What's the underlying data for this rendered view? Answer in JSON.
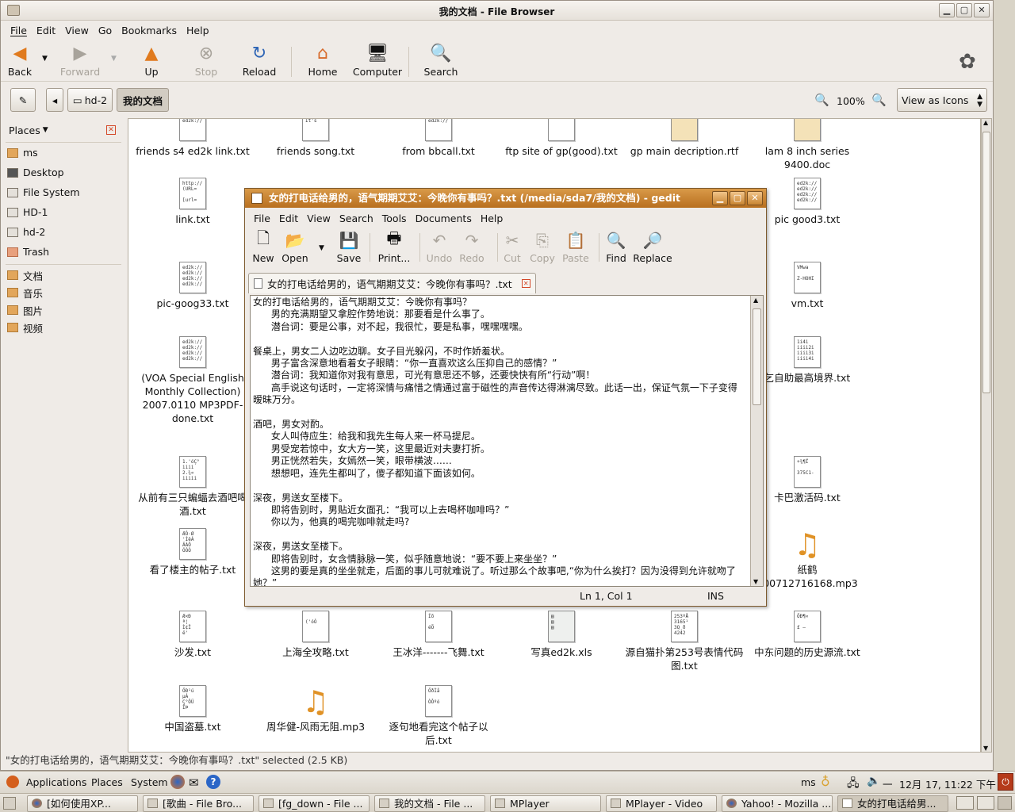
{
  "file_browser": {
    "window_title": "我的文档 - File Browser",
    "menu": [
      "File",
      "Edit",
      "View",
      "Go",
      "Bookmarks",
      "Help"
    ],
    "toolbar": {
      "back": "Back",
      "forward": "Forward",
      "up": "Up",
      "stop": "Stop",
      "reload": "Reload",
      "home": "Home",
      "computer": "Computer",
      "search": "Search"
    },
    "path": [
      "hd-2",
      "我的文档"
    ],
    "zoom": "100%",
    "view_mode": "View as Icons",
    "places_label": "Places",
    "places": [
      "ms",
      "Desktop",
      "File System",
      "HD-1",
      "hd-2",
      "Trash"
    ],
    "bookmarks": [
      "文档",
      "音乐",
      "图片",
      "视频"
    ],
    "files": {
      "f1": "friends s4 ed2k link.txt",
      "f2": "friends song.txt",
      "f3": "from bbcall.txt",
      "f4": "ftp site of gp(good).txt",
      "f5": "gp main decription.rtf",
      "f6": "lam 8 inch series 9400.doc",
      "f7": "link.txt",
      "f8": "pic good3.txt",
      "f9": "pic-goog33.txt",
      "f10": "vm.txt",
      "f11": "(VOA Special English Monthly Collection) 2007.0110 MP3PDF-done.txt",
      "f12": "乞自助最高境界.txt",
      "f13": "从前有三只蝙蝠去酒吧喝酒.txt",
      "f14": "卡巴激活码.txt",
      "f15": "看了楼主的帖子.txt",
      "f16": "纸鹤200712716168.mp3",
      "f17": "沙发.txt",
      "f18": "上海全攻略.txt",
      "f19": "王冰洋-------飞舞.txt",
      "f20": "写真ed2k.xls",
      "f21": "源自猫扑第253号表情代码图.txt",
      "f22": "中东问题的历史源流.txt",
      "f23": "中国盗墓.txt",
      "f24": "周华健-风雨无阻.mp3",
      "f25": "逐句地看完这个帖子以后.txt"
    },
    "status": "\"女的打电话给男的，语气期期艾艾：今晚你有事吗？.txt\" selected (2.5 KB)"
  },
  "gedit": {
    "window_title": "女的打电话给男的，语气期期艾艾：今晚你有事吗？.txt (/media/sda7/我的文档) - gedit",
    "menu": [
      "File",
      "Edit",
      "View",
      "Search",
      "Tools",
      "Documents",
      "Help"
    ],
    "toolbar": {
      "new": "New",
      "open": "Open",
      "save": "Save",
      "print": "Print...",
      "undo": "Undo",
      "redo": "Redo",
      "cut": "Cut",
      "copy": "Copy",
      "paste": "Paste",
      "find": "Find",
      "replace": "Replace"
    },
    "tab_label": "女的打电话给男的，语气期期艾艾：今晚你有事吗？.txt",
    "text": "女的打电话给男的，语气期期艾艾：今晚你有事吗？\n      男的充满期望又拿腔作势地说：那要看是什么事了。\n      潜台词：要是公事，对不起，我很忙，要是私事，嘿嘿嘿嘿。\n\n餐桌上，男女二人边吃边聊。女子目光躲闪，不时作娇羞状。\n      男子富含深意地看着女子眼睛：“你一直喜欢这么压抑自己的感情？”\n      潜台词：我知道你对我有意思，可光有意思还不够，还要快快有所“行动”啊！\n      高手说这句话时，一定将深情与痛惜之情通过富于磁性的声音传达得淋漓尽致。此话一出，保证气氛一下子变得暧昧万分。\n\n酒吧，男女对酌。\n      女人叫侍应生：给我和我先生每人来一杯马提尼。\n      男受宠若惊中，女大方一笑，这里最近对夫妻打折。\n      男正恍然若失，女嫣然一笑，眼带横波……\n      想想吧，连先生都叫了，傻子都知道下面该如何。\n\n深夜，男送女至楼下。\n      即将告别时，男贴近女面孔：“我可以上去喝杯咖啡吗？”\n      你以为，他真的喝完咖啡就走吗?\n\n深夜，男送女至楼下。\n      即将告别时，女含情脉脉一笑，似乎随意地说：“要不要上来坐坐？”\n      这男的要是真的坐坐就走，后面的事儿可就难说了。听过那么个故事吧,“你为什么挨打？因为没得到允许就吻了她？”",
    "cursor": "Ln 1, Col 1",
    "mode": "INS"
  },
  "panel": {
    "applications": "Applications",
    "places": "Places",
    "system": "System",
    "user": "ms",
    "date": "12月",
    "time": "17, 11:22 下午"
  },
  "tasks": [
    "[如何使用XP...",
    "[歌曲 - File Bro...",
    "[fg_down - File ...",
    "我的文档 - File ...",
    "MPlayer",
    "MPlayer - Video",
    "Yahoo! - Mozilla ...",
    "女的打电话给男..."
  ]
}
